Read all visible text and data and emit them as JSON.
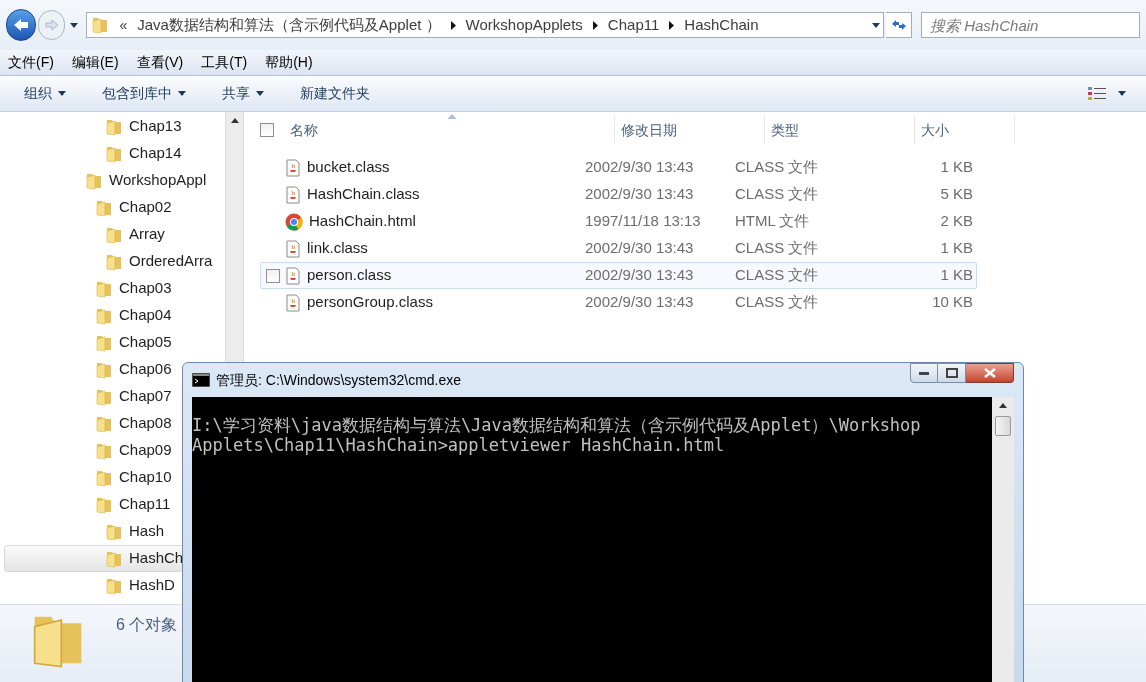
{
  "explorer": {
    "breadcrumb": {
      "overflow": "«",
      "segments": [
        "Java数据结构和算法（含示例代码及Applet ）",
        "WorkshopApplets",
        "Chap11",
        "HashChain"
      ]
    },
    "search": {
      "placeholder": "搜索 HashChain"
    },
    "menu": [
      "文件(F)",
      "编辑(E)",
      "查看(V)",
      "工具(T)",
      "帮助(H)"
    ],
    "commands": [
      {
        "label": "组织",
        "dropdown": true
      },
      {
        "label": "包含到库中",
        "dropdown": true
      },
      {
        "label": "共享",
        "dropdown": true
      },
      {
        "label": "新建文件夹",
        "dropdown": false
      }
    ],
    "tree_tail": [
      {
        "label": "Chap13",
        "selected": false
      },
      {
        "label": "Chap14",
        "selected": false
      }
    ],
    "tree": [
      {
        "label": "WorkshopAppl",
        "selected": false,
        "children": [
          {
            "label": "Chap02",
            "selected": false,
            "children": [
              {
                "label": "Array",
                "selected": false
              },
              {
                "label": "OrderedArra",
                "selected": false
              }
            ]
          },
          {
            "label": "Chap03",
            "selected": false
          },
          {
            "label": "Chap04",
            "selected": false
          },
          {
            "label": "Chap05",
            "selected": false
          },
          {
            "label": "Chap06",
            "selected": false
          },
          {
            "label": "Chap07",
            "selected": false
          },
          {
            "label": "Chap08",
            "selected": false
          },
          {
            "label": "Chap09",
            "selected": false
          },
          {
            "label": "Chap10",
            "selected": false
          },
          {
            "label": "Chap11",
            "selected": false,
            "children": [
              {
                "label": "Hash",
                "selected": false
              },
              {
                "label": "HashCh",
                "selected": true
              },
              {
                "label": "HashD",
                "selected": false
              }
            ]
          }
        ]
      }
    ],
    "select_all": {
      "checked": false
    },
    "columns": [
      {
        "label": "名称",
        "sorted": true
      },
      {
        "label": "修改日期",
        "sorted": false
      },
      {
        "label": "类型",
        "sorted": false
      },
      {
        "label": "大小",
        "sorted": false
      }
    ],
    "files": [
      {
        "name": "bucket.class",
        "modified": "2002/9/30 13:43",
        "type": "CLASS 文件",
        "size": "1 KB",
        "kind": "class",
        "highlighted": false
      },
      {
        "name": "HashChain.class",
        "modified": "2002/9/30 13:43",
        "type": "CLASS 文件",
        "size": "5 KB",
        "kind": "class",
        "highlighted": false
      },
      {
        "name": "HashChain.html",
        "modified": "1997/11/18 13:13",
        "type": "HTML 文件",
        "size": "2 KB",
        "kind": "html",
        "highlighted": false
      },
      {
        "name": "link.class",
        "modified": "2002/9/30 13:43",
        "type": "CLASS 文件",
        "size": "1 KB",
        "kind": "class",
        "highlighted": false
      },
      {
        "name": "person.class",
        "modified": "2002/9/30 13:43",
        "type": "CLASS 文件",
        "size": "1 KB",
        "kind": "class",
        "highlighted": true
      },
      {
        "name": "personGroup.class",
        "modified": "2002/9/30 13:43",
        "type": "CLASS 文件",
        "size": "10 KB",
        "kind": "class",
        "highlighted": false
      }
    ],
    "status": "6 个对象"
  },
  "console": {
    "title": "管理员: C:\\Windows\\system32\\cmd.exe",
    "lines": [
      "I:\\学习资料\\java数据结构与算法\\Java数据结构和算法（含示例代码及Applet）\\Workshop",
      "Applets\\Chap11\\HashChain>appletviewer HashChain.html"
    ]
  }
}
